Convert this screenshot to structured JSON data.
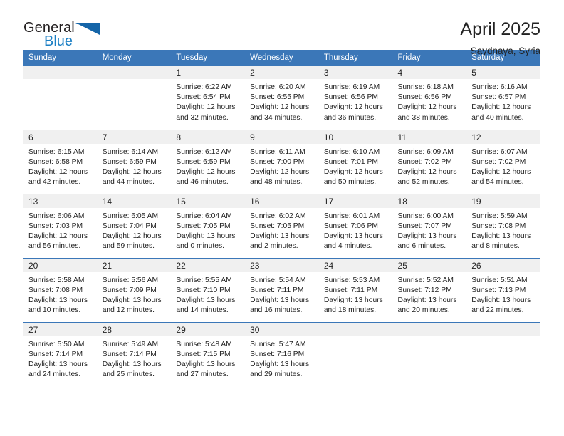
{
  "brand": {
    "name_line1": "General",
    "name_line2": "Blue",
    "triangle_icon": "triangle-icon",
    "color_dark": "#231f20",
    "color_blue": "#1b7fc4",
    "color_triangle": "#1565a8"
  },
  "header": {
    "title": "April 2025",
    "subtitle": "Saydnaya, Syria",
    "accent_color": "#3b77b8",
    "daynum_background": "#f0f0f0"
  },
  "weekdays": [
    "Sunday",
    "Monday",
    "Tuesday",
    "Wednesday",
    "Thursday",
    "Friday",
    "Saturday"
  ],
  "weeks": [
    [
      {
        "day": "",
        "blank": true
      },
      {
        "day": "",
        "blank": true
      },
      {
        "day": "1",
        "sunrise": "Sunrise: 6:22 AM",
        "sunset": "Sunset: 6:54 PM",
        "daylight1": "Daylight: 12 hours",
        "daylight2": "and 32 minutes."
      },
      {
        "day": "2",
        "sunrise": "Sunrise: 6:20 AM",
        "sunset": "Sunset: 6:55 PM",
        "daylight1": "Daylight: 12 hours",
        "daylight2": "and 34 minutes."
      },
      {
        "day": "3",
        "sunrise": "Sunrise: 6:19 AM",
        "sunset": "Sunset: 6:56 PM",
        "daylight1": "Daylight: 12 hours",
        "daylight2": "and 36 minutes."
      },
      {
        "day": "4",
        "sunrise": "Sunrise: 6:18 AM",
        "sunset": "Sunset: 6:56 PM",
        "daylight1": "Daylight: 12 hours",
        "daylight2": "and 38 minutes."
      },
      {
        "day": "5",
        "sunrise": "Sunrise: 6:16 AM",
        "sunset": "Sunset: 6:57 PM",
        "daylight1": "Daylight: 12 hours",
        "daylight2": "and 40 minutes."
      }
    ],
    [
      {
        "day": "6",
        "sunrise": "Sunrise: 6:15 AM",
        "sunset": "Sunset: 6:58 PM",
        "daylight1": "Daylight: 12 hours",
        "daylight2": "and 42 minutes."
      },
      {
        "day": "7",
        "sunrise": "Sunrise: 6:14 AM",
        "sunset": "Sunset: 6:59 PM",
        "daylight1": "Daylight: 12 hours",
        "daylight2": "and 44 minutes."
      },
      {
        "day": "8",
        "sunrise": "Sunrise: 6:12 AM",
        "sunset": "Sunset: 6:59 PM",
        "daylight1": "Daylight: 12 hours",
        "daylight2": "and 46 minutes."
      },
      {
        "day": "9",
        "sunrise": "Sunrise: 6:11 AM",
        "sunset": "Sunset: 7:00 PM",
        "daylight1": "Daylight: 12 hours",
        "daylight2": "and 48 minutes."
      },
      {
        "day": "10",
        "sunrise": "Sunrise: 6:10 AM",
        "sunset": "Sunset: 7:01 PM",
        "daylight1": "Daylight: 12 hours",
        "daylight2": "and 50 minutes."
      },
      {
        "day": "11",
        "sunrise": "Sunrise: 6:09 AM",
        "sunset": "Sunset: 7:02 PM",
        "daylight1": "Daylight: 12 hours",
        "daylight2": "and 52 minutes."
      },
      {
        "day": "12",
        "sunrise": "Sunrise: 6:07 AM",
        "sunset": "Sunset: 7:02 PM",
        "daylight1": "Daylight: 12 hours",
        "daylight2": "and 54 minutes."
      }
    ],
    [
      {
        "day": "13",
        "sunrise": "Sunrise: 6:06 AM",
        "sunset": "Sunset: 7:03 PM",
        "daylight1": "Daylight: 12 hours",
        "daylight2": "and 56 minutes."
      },
      {
        "day": "14",
        "sunrise": "Sunrise: 6:05 AM",
        "sunset": "Sunset: 7:04 PM",
        "daylight1": "Daylight: 12 hours",
        "daylight2": "and 59 minutes."
      },
      {
        "day": "15",
        "sunrise": "Sunrise: 6:04 AM",
        "sunset": "Sunset: 7:05 PM",
        "daylight1": "Daylight: 13 hours",
        "daylight2": "and 0 minutes."
      },
      {
        "day": "16",
        "sunrise": "Sunrise: 6:02 AM",
        "sunset": "Sunset: 7:05 PM",
        "daylight1": "Daylight: 13 hours",
        "daylight2": "and 2 minutes."
      },
      {
        "day": "17",
        "sunrise": "Sunrise: 6:01 AM",
        "sunset": "Sunset: 7:06 PM",
        "daylight1": "Daylight: 13 hours",
        "daylight2": "and 4 minutes."
      },
      {
        "day": "18",
        "sunrise": "Sunrise: 6:00 AM",
        "sunset": "Sunset: 7:07 PM",
        "daylight1": "Daylight: 13 hours",
        "daylight2": "and 6 minutes."
      },
      {
        "day": "19",
        "sunrise": "Sunrise: 5:59 AM",
        "sunset": "Sunset: 7:08 PM",
        "daylight1": "Daylight: 13 hours",
        "daylight2": "and 8 minutes."
      }
    ],
    [
      {
        "day": "20",
        "sunrise": "Sunrise: 5:58 AM",
        "sunset": "Sunset: 7:08 PM",
        "daylight1": "Daylight: 13 hours",
        "daylight2": "and 10 minutes."
      },
      {
        "day": "21",
        "sunrise": "Sunrise: 5:56 AM",
        "sunset": "Sunset: 7:09 PM",
        "daylight1": "Daylight: 13 hours",
        "daylight2": "and 12 minutes."
      },
      {
        "day": "22",
        "sunrise": "Sunrise: 5:55 AM",
        "sunset": "Sunset: 7:10 PM",
        "daylight1": "Daylight: 13 hours",
        "daylight2": "and 14 minutes."
      },
      {
        "day": "23",
        "sunrise": "Sunrise: 5:54 AM",
        "sunset": "Sunset: 7:11 PM",
        "daylight1": "Daylight: 13 hours",
        "daylight2": "and 16 minutes."
      },
      {
        "day": "24",
        "sunrise": "Sunrise: 5:53 AM",
        "sunset": "Sunset: 7:11 PM",
        "daylight1": "Daylight: 13 hours",
        "daylight2": "and 18 minutes."
      },
      {
        "day": "25",
        "sunrise": "Sunrise: 5:52 AM",
        "sunset": "Sunset: 7:12 PM",
        "daylight1": "Daylight: 13 hours",
        "daylight2": "and 20 minutes."
      },
      {
        "day": "26",
        "sunrise": "Sunrise: 5:51 AM",
        "sunset": "Sunset: 7:13 PM",
        "daylight1": "Daylight: 13 hours",
        "daylight2": "and 22 minutes."
      }
    ],
    [
      {
        "day": "27",
        "sunrise": "Sunrise: 5:50 AM",
        "sunset": "Sunset: 7:14 PM",
        "daylight1": "Daylight: 13 hours",
        "daylight2": "and 24 minutes."
      },
      {
        "day": "28",
        "sunrise": "Sunrise: 5:49 AM",
        "sunset": "Sunset: 7:14 PM",
        "daylight1": "Daylight: 13 hours",
        "daylight2": "and 25 minutes."
      },
      {
        "day": "29",
        "sunrise": "Sunrise: 5:48 AM",
        "sunset": "Sunset: 7:15 PM",
        "daylight1": "Daylight: 13 hours",
        "daylight2": "and 27 minutes."
      },
      {
        "day": "30",
        "sunrise": "Sunrise: 5:47 AM",
        "sunset": "Sunset: 7:16 PM",
        "daylight1": "Daylight: 13 hours",
        "daylight2": "and 29 minutes."
      },
      {
        "day": "",
        "blank": true
      },
      {
        "day": "",
        "blank": true
      },
      {
        "day": "",
        "blank": true
      }
    ]
  ]
}
